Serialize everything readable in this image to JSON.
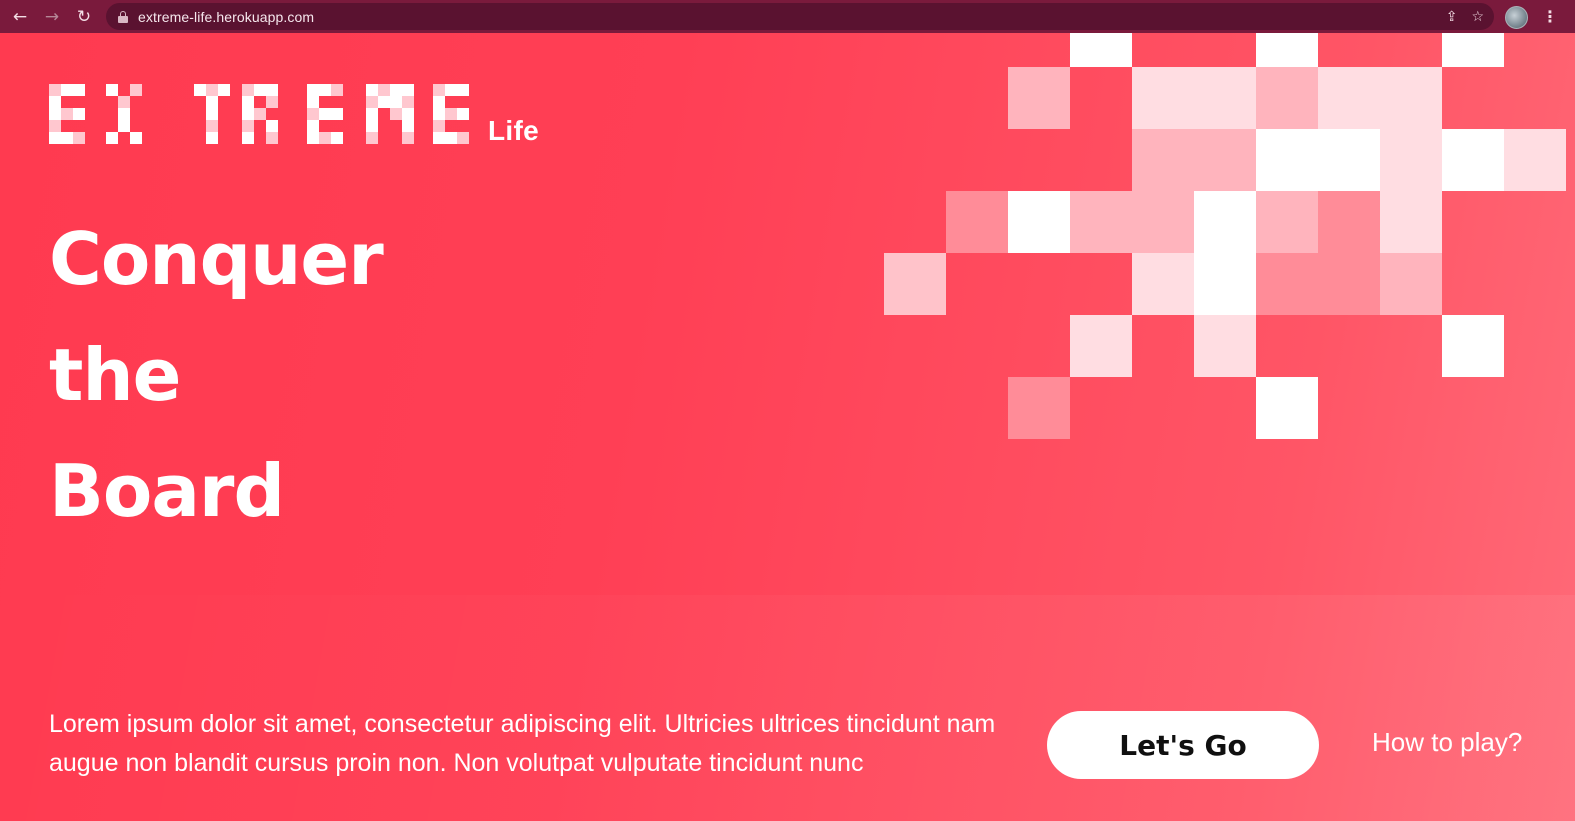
{
  "browser": {
    "url": "extreme-life.herokuapp.com",
    "back_icon": "arrow-left-icon",
    "forward_icon": "arrow-right-icon",
    "reload_icon": "reload-icon",
    "share_icon": "share-icon",
    "bookmark_icon": "star-icon",
    "menu_icon": "kebab-icon",
    "chrome_color": "#7a1a3c"
  },
  "hero": {
    "logo_text": "EXTREME",
    "logo_suffix": "Life",
    "headline": [
      "Conquer",
      "the",
      "Board"
    ],
    "description": "Lorem ipsum dolor sit amet, consectetur adipiscing elit. Ultricies ultrices tincidunt nam augue non blandit cursus proin non. Non volutpat vulputate tincidunt nunc",
    "cta_label": "Let's Go",
    "secondary_link": "How to play?"
  },
  "colors": {
    "background": "#ff3b50",
    "accent_white": "#ffffff"
  }
}
